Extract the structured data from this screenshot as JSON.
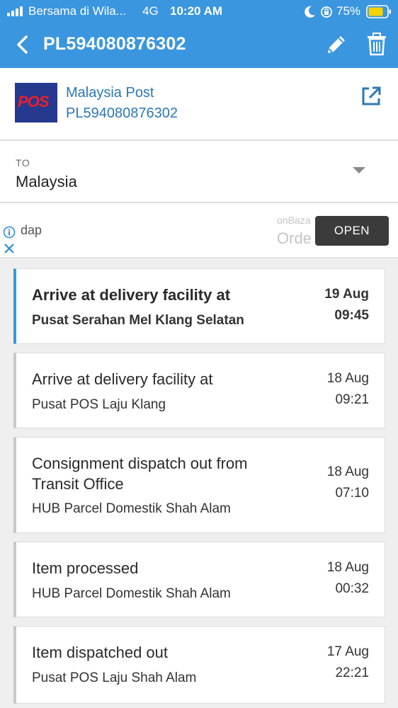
{
  "status_bar": {
    "carrier": "Bersama di Wila...",
    "network": "4G",
    "time": "10:20 AM",
    "battery": "75%"
  },
  "app_bar": {
    "title": "PL594080876302",
    "color": "#3a96de",
    "icons": [
      "back-arrow-icon",
      "pencil-icon",
      "trash-icon"
    ]
  },
  "carrier": {
    "logo_text": "POS",
    "name": "Malaysia Post",
    "tracking_number": "PL594080876302"
  },
  "destination": {
    "label": "TO",
    "value": "Malaysia"
  },
  "ad": {
    "text": "dap",
    "sub_text": "onBaza",
    "sub_text2": "Orde",
    "button_label": "OPEN"
  },
  "events": [
    {
      "title": "Arrive at delivery facility at",
      "location": "Pusat Serahan Mel Klang Selatan",
      "date": "19 Aug",
      "time": "09:45",
      "current": true
    },
    {
      "title": "Arrive at delivery facility at",
      "location": "Pusat POS Laju Klang",
      "date": "18 Aug",
      "time": "09:21",
      "current": false
    },
    {
      "title": "Consignment dispatch out from Transit Office",
      "location": "HUB Parcel Domestik Shah Alam",
      "date": "18 Aug",
      "time": "07:10",
      "current": false
    },
    {
      "title": "Item processed",
      "location": "HUB Parcel Domestik Shah Alam",
      "date": "18 Aug",
      "time": "00:32",
      "current": false
    },
    {
      "title": "Item dispatched out",
      "location": "Pusat POS Laju Shah Alam",
      "date": "17 Aug",
      "time": "22:21",
      "current": false
    }
  ]
}
